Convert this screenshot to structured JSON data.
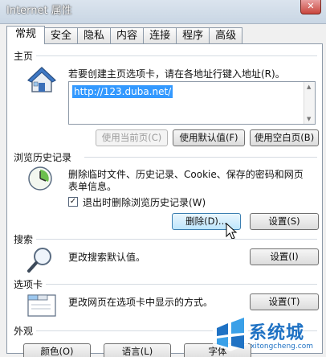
{
  "window": {
    "title": "Internet 属性",
    "close_label": "✕"
  },
  "tabs": [
    "常规",
    "安全",
    "隐私",
    "内容",
    "连接",
    "程序",
    "高级"
  ],
  "home": {
    "group": "主页",
    "hint": "若要创建主页选项卡，请在各地址行键入地址(R)。",
    "url": "http://123.duba.net/",
    "buttons": {
      "current": "使用当前页(C)",
      "default": "使用默认值(F)",
      "blank": "使用空白页(B)"
    }
  },
  "history": {
    "group": "浏览历史记录",
    "desc_line1": "删除临时文件、历史记录、Cookie、保存的密码和网页",
    "desc_line2": "表单信息。",
    "checkbox_label": "退出时删除浏览历史记录(W)",
    "checkbox_checked": "✓",
    "delete_button": "删除(D)...",
    "settings_button": "设置(S)"
  },
  "search": {
    "group": "搜索",
    "desc": "更改搜索默认值。",
    "settings_button": "设置(I)"
  },
  "tabs_section": {
    "group": "选项卡",
    "desc": "更改网页在选项卡中显示的方式。",
    "settings_button": "设置(T)"
  },
  "appearance": {
    "group": "外观",
    "colors_button": "颜色(O)",
    "languages_button": "语言(L)",
    "fonts_button": "字体"
  },
  "watermark": {
    "brand": "系统城",
    "url": "xitongcheng.com"
  },
  "colors": {
    "accent": "#3399ff",
    "panel": "#ffffff",
    "dialog_bg": "#f0f0f0",
    "brand": "#1f72c4"
  }
}
